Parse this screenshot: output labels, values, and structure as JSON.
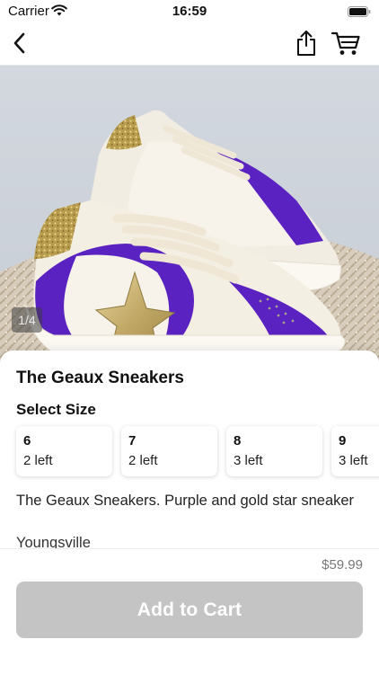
{
  "status_bar": {
    "carrier": "Carrier",
    "time": "16:59"
  },
  "nav": {
    "back_icon": "chevron-left-icon",
    "share_icon": "share-icon",
    "cart_icon": "cart-icon"
  },
  "gallery": {
    "counter": "1/4"
  },
  "product": {
    "title": "The Geaux Sneakers",
    "size_heading": "Select Size",
    "sizes": [
      {
        "size": "6",
        "stock": "2 left"
      },
      {
        "size": "7",
        "stock": "2 left"
      },
      {
        "size": "8",
        "stock": "3 left"
      },
      {
        "size": "9",
        "stock": "3 left"
      }
    ],
    "description": "The Geaux Sneakers. Purple and gold star sneaker",
    "location": "Youngsville"
  },
  "footer": {
    "price": "$59.99",
    "add_to_cart_label": "Add to Cart"
  },
  "colors": {
    "button_disabled": "#c4c4c4",
    "shoe_purple": "#5b1fc2",
    "shoe_gold": "#c9b06a"
  }
}
